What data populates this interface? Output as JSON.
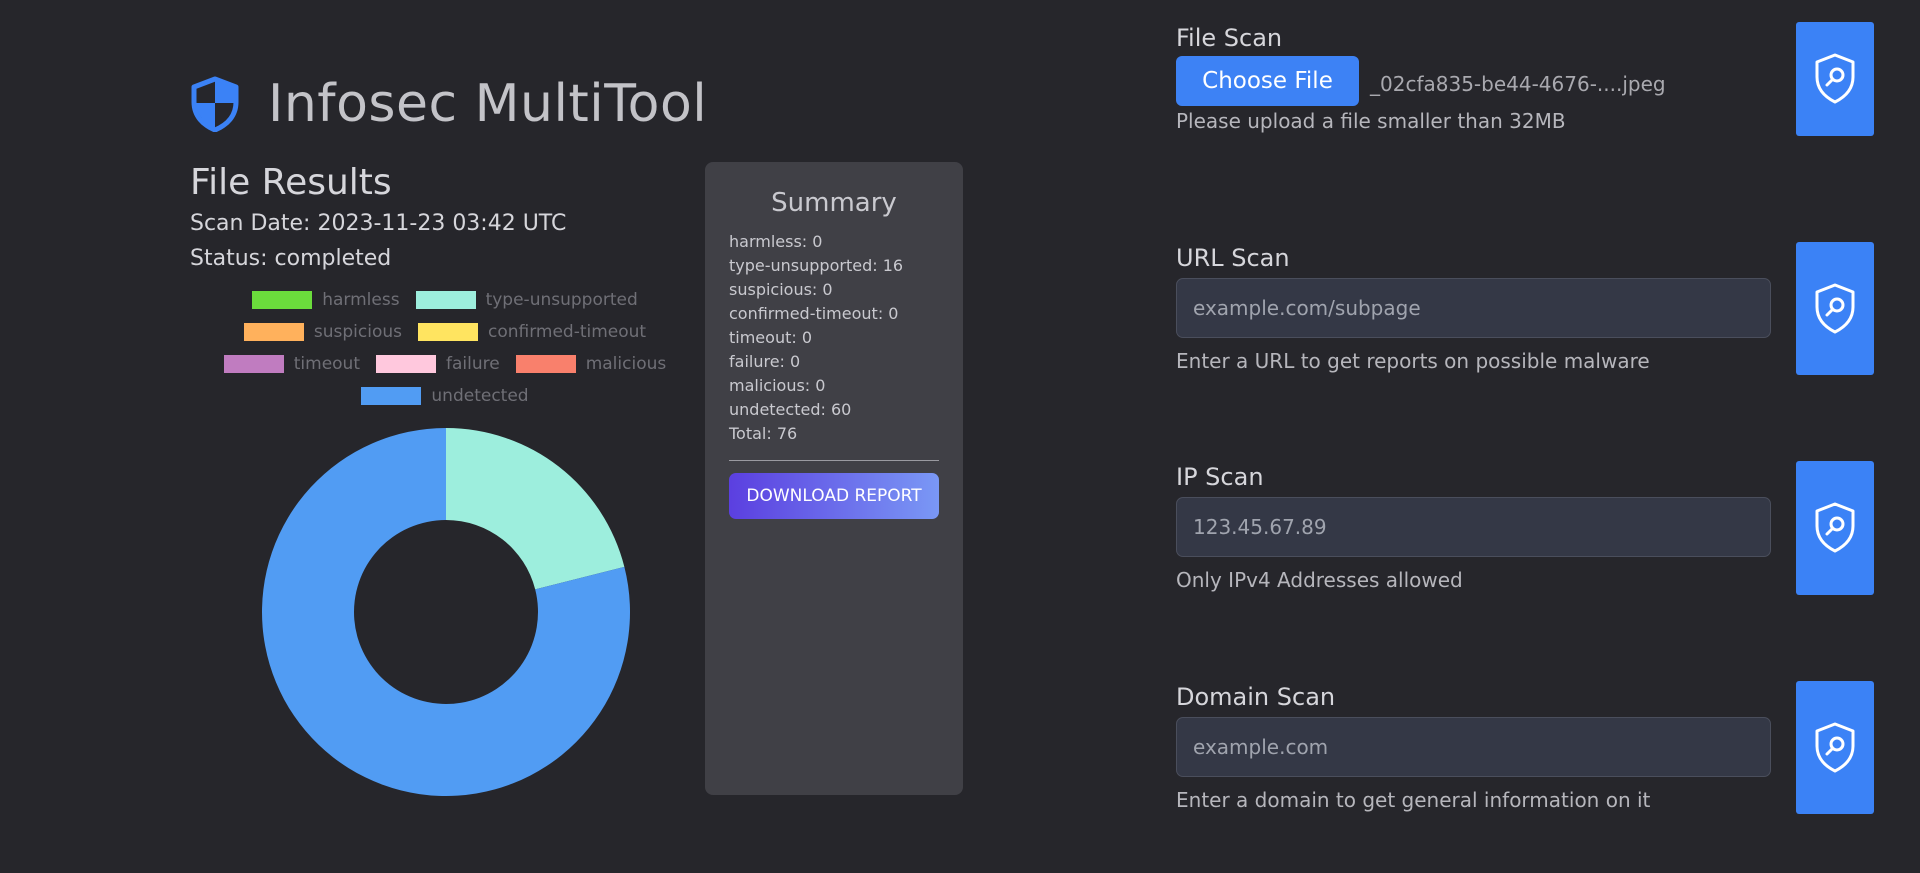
{
  "header": {
    "title": "Infosec MultiTool",
    "icon": "shield-icon"
  },
  "file_results": {
    "title": "File Results",
    "scan_date": "Scan Date: 2023-11-23 03:42 UTC",
    "status": "Status: completed"
  },
  "legend": [
    {
      "label": "harmless",
      "color": "#6bdc3c"
    },
    {
      "label": "type-unsupported",
      "color": "#9deedd"
    },
    {
      "label": "suspicious",
      "color": "#ffb15c"
    },
    {
      "label": "confirmed-timeout",
      "color": "#ffe460"
    },
    {
      "label": "timeout",
      "color": "#c07cc0"
    },
    {
      "label": "failure",
      "color": "#ffc8dd"
    },
    {
      "label": "malicious",
      "color": "#f9806c"
    },
    {
      "label": "undetected",
      "color": "#519cf3"
    }
  ],
  "chart_data": {
    "type": "pie",
    "donut": true,
    "categories": [
      "harmless",
      "type-unsupported",
      "suspicious",
      "confirmed-timeout",
      "timeout",
      "failure",
      "malicious",
      "undetected"
    ],
    "values": [
      0,
      16,
      0,
      0,
      0,
      0,
      0,
      60
    ],
    "colors": [
      "#6bdc3c",
      "#9deedd",
      "#ffb15c",
      "#ffe460",
      "#c07cc0",
      "#ffc8dd",
      "#f9806c",
      "#519cf3"
    ],
    "legend_position": "top"
  },
  "summary": {
    "title": "Summary",
    "lines": [
      "harmless: 0",
      "type-unsupported: 16",
      "suspicious: 0",
      "confirmed-timeout: 0",
      "timeout: 0",
      "failure: 0",
      "malicious: 0",
      "undetected: 60",
      "Total: 76"
    ],
    "download_label": "DOWNLOAD REPORT"
  },
  "file_scan": {
    "label": "File Scan",
    "choose_label": "Choose File",
    "file_name": "_02cfa835-be44-4676-....jpeg",
    "hint": "Please upload a file smaller than 32MB"
  },
  "url_scan": {
    "label": "URL Scan",
    "placeholder": "example.com/subpage",
    "hint": "Enter a URL to get reports on possible malware"
  },
  "ip_scan": {
    "label": "IP Scan",
    "value": "123.45.67.89",
    "hint": "Only IPv4 Addresses allowed"
  },
  "domain_scan": {
    "label": "Domain Scan",
    "placeholder": "example.com",
    "hint": "Enter a domain to get general information on it"
  },
  "scan_button_icon": "shield-search-icon"
}
